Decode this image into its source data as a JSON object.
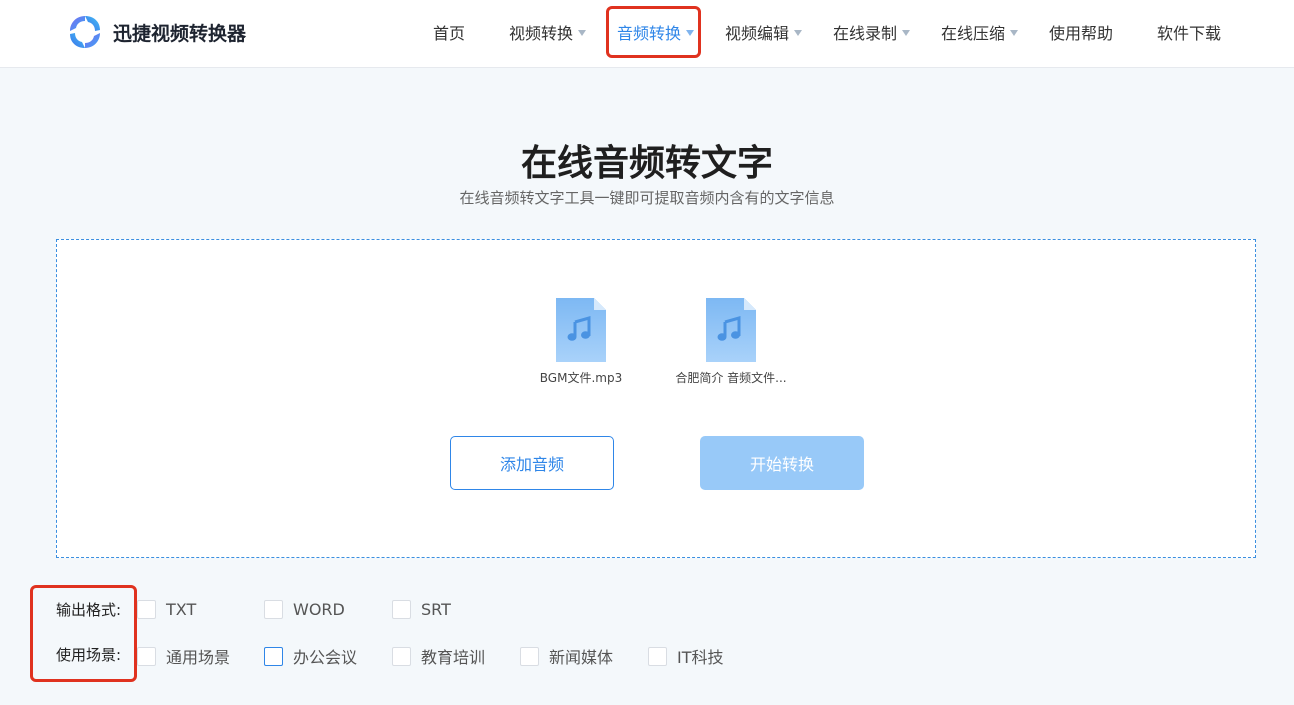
{
  "header": {
    "logo_text": "迅捷视频转换器",
    "nav": [
      {
        "label": "首页",
        "has_dropdown": false,
        "active": false
      },
      {
        "label": "视频转换",
        "has_dropdown": true,
        "active": false
      },
      {
        "label": "音频转换",
        "has_dropdown": true,
        "active": true
      },
      {
        "label": "视频编辑",
        "has_dropdown": true,
        "active": false
      },
      {
        "label": "在线录制",
        "has_dropdown": true,
        "active": false
      },
      {
        "label": "在线压缩",
        "has_dropdown": true,
        "active": false
      },
      {
        "label": "使用帮助",
        "has_dropdown": false,
        "active": false
      },
      {
        "label": "软件下载",
        "has_dropdown": false,
        "active": false
      }
    ]
  },
  "main": {
    "title": "在线音频转文字",
    "subtitle": "在线音频转文字工具一键即可提取音频内含有的文字信息"
  },
  "upload": {
    "files": [
      {
        "name": "BGM文件.mp3",
        "icon": "audio-file-icon"
      },
      {
        "name": "合肥简介 音频文件...",
        "icon": "audio-file-icon"
      }
    ],
    "add_button": "添加音频",
    "start_button": "开始转换"
  },
  "options": {
    "format_label": "输出格式:",
    "formats": [
      "TXT",
      "WORD",
      "SRT"
    ],
    "scene_label": "使用场景:",
    "scenes": [
      "通用场景",
      "办公会议",
      "教育培训",
      "新闻媒体",
      "IT科技"
    ]
  },
  "colors": {
    "accent": "#2f86e8",
    "highlight": "#e0321f",
    "start_button_disabled": "#98c9f8",
    "page_bg": "#f4f8fb"
  }
}
